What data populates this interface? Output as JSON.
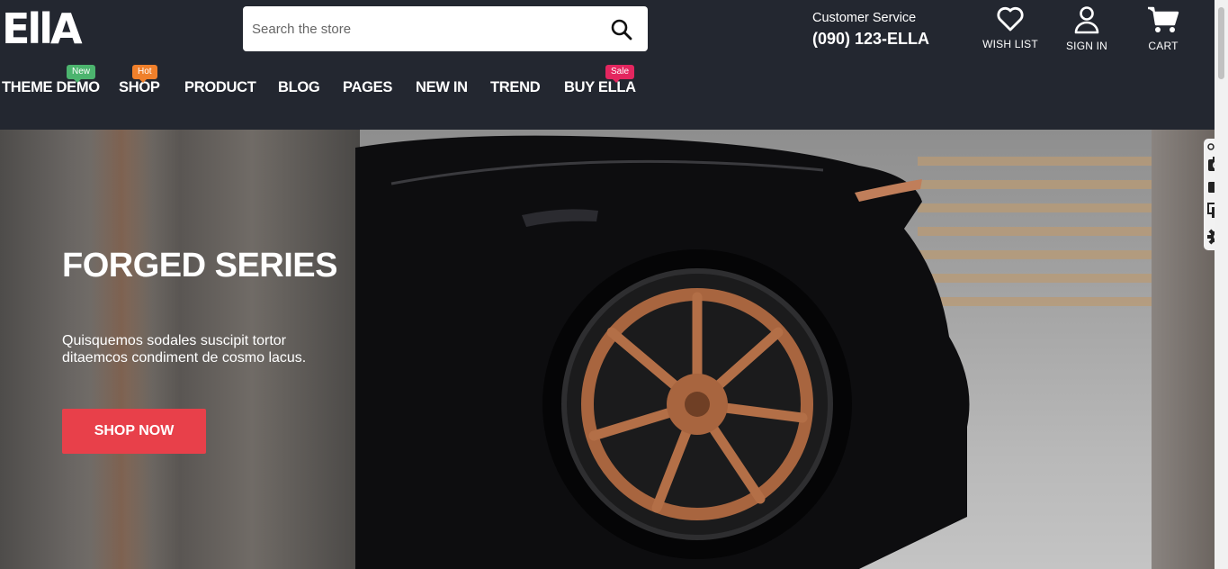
{
  "header": {
    "logo": "EllA",
    "search": {
      "placeholder": "Search the store"
    },
    "customer_service": {
      "label": "Customer Service",
      "phone": "(090) 123-ELLA"
    },
    "actions": {
      "wishlist": "WISH LIST",
      "signin": "SIGN IN",
      "cart": "CART"
    }
  },
  "nav": {
    "items": [
      {
        "label": "THEME DEMO",
        "badge": "New",
        "badge_color": "#4cb46e"
      },
      {
        "label": "SHOP",
        "badge": "Hot",
        "badge_color": "#f0802b"
      },
      {
        "label": "PRODUCT"
      },
      {
        "label": "BLOG"
      },
      {
        "label": "PAGES"
      },
      {
        "label": "NEW IN"
      },
      {
        "label": "TREND"
      },
      {
        "label": "BUY ELLA",
        "badge": "Sale",
        "badge_color": "#e3265f"
      }
    ]
  },
  "hero": {
    "title": "FORGED SERIES",
    "description": "Quisquemos sodales suscipit tortor ditaemcos condiment de cosmo lacus.",
    "button": "SHOP NOW",
    "button_color": "#e8404a"
  },
  "colors": {
    "header_bg": "#232730",
    "accent": "#e8404a"
  }
}
